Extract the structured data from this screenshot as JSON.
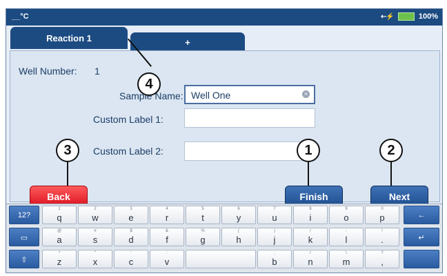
{
  "statusbar": {
    "temperature": "__°C",
    "connection_icon": "plug-icon",
    "battery_percent": "100%",
    "battery_color": "#6cc24a"
  },
  "tabs": [
    {
      "label": "Reaction 1"
    },
    {
      "label": "+"
    }
  ],
  "form": {
    "well_number_label": "Well Number:",
    "well_number_value": "1",
    "sample_name_label": "Sample Name:",
    "sample_name_value": "Well One",
    "custom_label_1": "Custom Label 1:",
    "custom_label_1_value": "",
    "custom_label_2": "Custom Label 2:",
    "custom_label_2_value": ""
  },
  "buttons": {
    "back": "Back",
    "finish": "Finish",
    "next": "Next"
  },
  "callouts": [
    "1",
    "2",
    "3",
    "4"
  ],
  "keyboard": {
    "rows": [
      {
        "left": "12?",
        "keys": [
          {
            "main": "q",
            "sub": "1"
          },
          {
            "main": "w",
            "sub": "2"
          },
          {
            "main": "e",
            "sub": "3"
          },
          {
            "main": "r",
            "sub": "4"
          },
          {
            "main": "t",
            "sub": "5"
          },
          {
            "main": "y",
            "sub": "6"
          },
          {
            "main": "u",
            "sub": "7"
          },
          {
            "main": "i",
            "sub": "8"
          },
          {
            "main": "o",
            "sub": "9"
          },
          {
            "main": "p",
            "sub": "0"
          }
        ],
        "right": "←"
      },
      {
        "left": "▭",
        "keys": [
          {
            "main": "a",
            "sub": "@"
          },
          {
            "main": "s",
            "sub": "#"
          },
          {
            "main": "d",
            "sub": "$"
          },
          {
            "main": "f",
            "sub": "&"
          },
          {
            "main": "g",
            "sub": "%"
          },
          {
            "main": "h",
            "sub": "("
          },
          {
            "main": "j",
            "sub": ")"
          },
          {
            "main": "k",
            "sub": "/"
          },
          {
            "main": "l",
            "sub": "-"
          },
          {
            "main": ".",
            "sub": "!"
          }
        ],
        "right": "↵"
      },
      {
        "left": "⇧",
        "keys": [
          {
            "main": "z",
            "sub": "*"
          },
          {
            "main": "x",
            "sub": "\""
          },
          {
            "main": "c",
            "sub": "'"
          },
          {
            "main": "v",
            "sub": ":"
          },
          {
            "main": "",
            "sub": ""
          },
          {
            "main": "b",
            "sub": ";"
          },
          {
            "main": "n",
            "sub": "/"
          },
          {
            "main": "m",
            "sub": "\\"
          },
          {
            "main": ",",
            "sub": "?"
          }
        ],
        "right": ""
      }
    ],
    "handle": "••••"
  }
}
